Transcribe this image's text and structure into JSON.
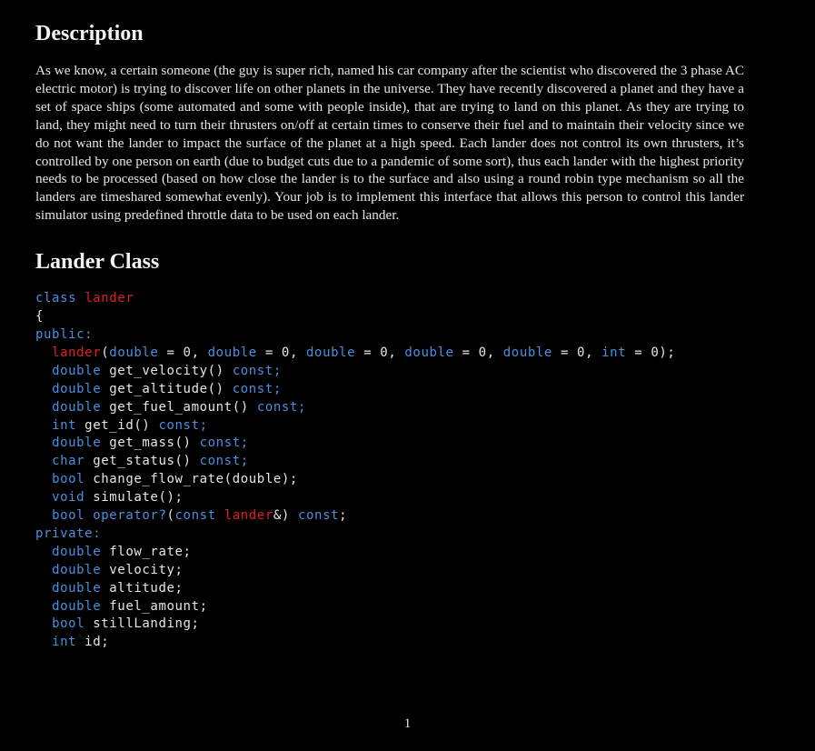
{
  "description": {
    "heading": "Description",
    "paragraph": "As we know, a certain someone (the guy is super rich, named his car company after the scientist who discovered the 3 phase AC electric motor) is trying to discover life on other planets in the universe. They have recently discovered a planet and they have a set of space ships (some automated and some with people inside), that are trying to land on this planet. As they are trying to land, they might need to turn their thrusters on/off at certain times to conserve their fuel and to maintain their velocity since we do not want the lander to impact the surface of the planet at a high speed. Each lander does not control its own thrusters, it’s controlled by one person on earth (due to budget cuts due to a pandemic of some sort), thus each lander with the highest priority needs to be processed (based on how close the lander is to the surface and also using a round robin type mechanism so all the landers are timeshared somewhat evenly). Your job is to implement this interface that allows this person to control this lander simulator using predefined throttle data to be used on each lander."
  },
  "lander_class": {
    "heading": "Lander Class",
    "code": {
      "class_kw": "class",
      "class_name": "lander",
      "open_brace": "{",
      "public_label": "public:",
      "ctor_name": "lander",
      "ctor_args": "(double = 0, double = 0, double = 0, double = 0, double = 0, int = 0);",
      "methods": [
        {
          "type": "double",
          "sig": "get_velocity()",
          "qual": "const;"
        },
        {
          "type": "double",
          "sig": "get_altitude()",
          "qual": "const;"
        },
        {
          "type": "double",
          "sig": "get_fuel_amount()",
          "qual": "const;"
        },
        {
          "type": "int",
          "sig": "get_id()",
          "qual": "const;"
        },
        {
          "type": "double",
          "sig": "get_mass()",
          "qual": "const;"
        },
        {
          "type": "char",
          "sig": "get_status()",
          "qual": "const;"
        },
        {
          "type": "bool",
          "sig": "change_flow_rate(double);",
          "qual": ""
        },
        {
          "type": "void",
          "sig": "simulate();",
          "qual": ""
        }
      ],
      "operator_line": "bool operator?(const lander&) const;",
      "private_label": "private:",
      "fields": [
        {
          "type": "double",
          "name": "flow_rate;"
        },
        {
          "type": "double",
          "name": "velocity;"
        },
        {
          "type": "double",
          "name": "altitude;"
        },
        {
          "type": "double",
          "name": "fuel_amount;"
        },
        {
          "type": "bool",
          "name": "stillLanding;"
        },
        {
          "type": "int",
          "name": "id;"
        }
      ]
    }
  },
  "page_number": "1",
  "colors": {
    "keyword": "#4a8fe0",
    "class_name": "#e02020",
    "background": "#000000",
    "text": "#e6e6e6"
  }
}
